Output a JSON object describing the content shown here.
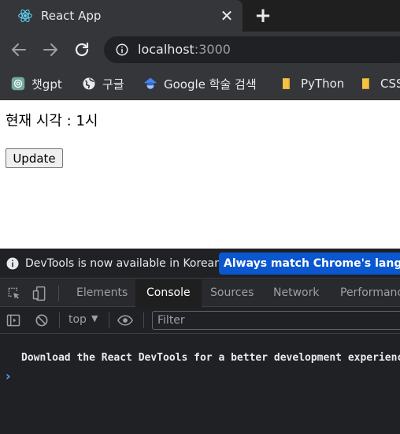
{
  "browser": {
    "tab": {
      "title": "React App",
      "close_glyph": "✕",
      "favicon": "react-logo-icon"
    },
    "new_tab_glyph": "+",
    "url": {
      "host": "localhost",
      "port": ":3000"
    },
    "bookmarks": [
      {
        "label": "챗gpt",
        "icon": "chatgpt-icon"
      },
      {
        "label": "구글",
        "icon": "globe-icon"
      },
      {
        "label": "Google 학술 검색",
        "icon": "google-scholar-icon"
      },
      {
        "label": "PyThon",
        "icon": "folder-icon"
      },
      {
        "label": "CSS",
        "icon": "folder-icon"
      }
    ]
  },
  "page": {
    "clock_text": "현재 시각 : 1시",
    "update_label": "Update"
  },
  "devtools": {
    "info_text": "DevTools is now available in Korean!",
    "info_button": "Always match Chrome's language",
    "tabs": [
      "Elements",
      "Console",
      "Sources",
      "Network",
      "Performance"
    ],
    "active_tab": "Console",
    "context": "top",
    "caret": "▼",
    "filter_placeholder": "Filter",
    "log_message": "Download the React DevTools for a better development experience",
    "prompt_glyph": "›"
  },
  "colors": {
    "tab_bg": "#35363a",
    "strip_bg": "#1f1f1f",
    "accent_blue": "#0b57d0",
    "prompt_blue": "#5e9efc"
  }
}
